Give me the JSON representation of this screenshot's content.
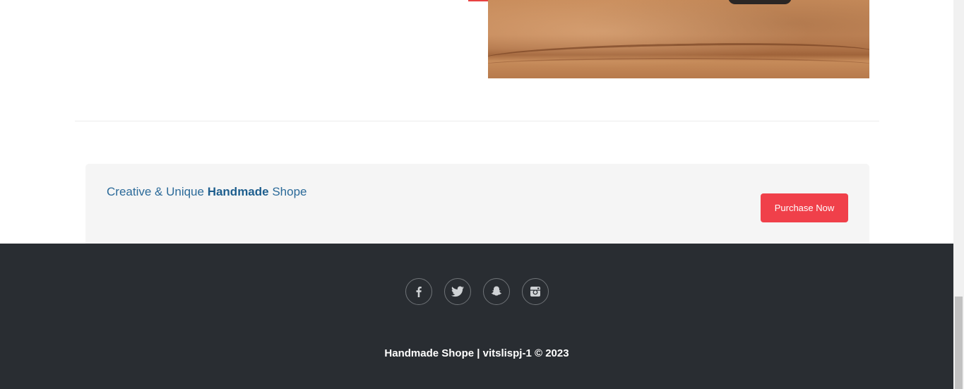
{
  "cta": {
    "title_prefix": "Creative & Unique ",
    "title_bold": "Handmade",
    "title_suffix": " Shope",
    "button_label": "Purchase Now"
  },
  "footer": {
    "social": [
      {
        "icon": "facebook-icon"
      },
      {
        "icon": "twitter-icon"
      },
      {
        "icon": "snapchat-icon"
      },
      {
        "icon": "instagram-icon"
      }
    ],
    "copyright": "Handmade Shope | vitslispj-1 © 2023"
  },
  "colors": {
    "accent": "#f0404a",
    "title_blue": "#2b6a99",
    "footer_bg": "#292d32"
  }
}
